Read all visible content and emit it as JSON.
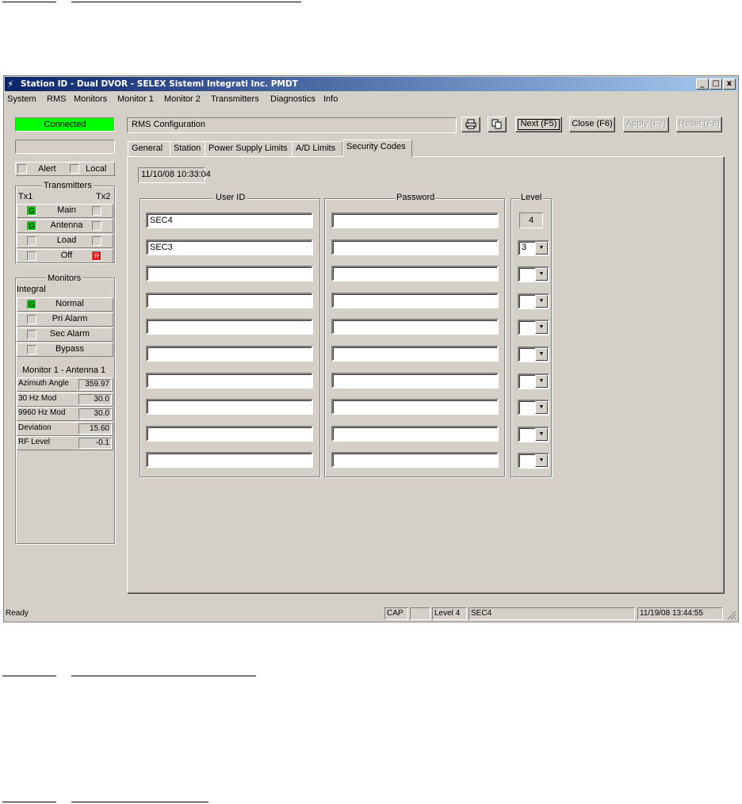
{
  "window": {
    "title": "Station ID - Dual DVOR - SELEX Sistemi Integrati Inc. PMDT",
    "controls": {
      "minimize": "_",
      "maximize": "□",
      "close": "x"
    }
  },
  "menu": [
    "System",
    "RMS",
    "Monitors",
    "Monitor 1",
    "Monitor 2",
    "Transmitters",
    "Diagnostics",
    "Info"
  ],
  "left_panel": {
    "connection_status": "Connected",
    "status_color": "#00ff00",
    "alert_label": "Alert",
    "local_label": "Local",
    "transmitters": {
      "title": "Transmitters",
      "tx1": "Tx1",
      "tx2": "Tx2",
      "rows": [
        {
          "label": "Main",
          "tx1": "G",
          "tx2": ""
        },
        {
          "label": "Antenna",
          "tx1": "G",
          "tx2": ""
        },
        {
          "label": "Load",
          "tx1": "",
          "tx2": ""
        },
        {
          "label": "Off",
          "tx1": "",
          "tx2": "R"
        }
      ]
    },
    "monitors": {
      "title": "Monitors",
      "integral": "Integral",
      "rows": [
        {
          "label": "Normal",
          "ind": "G"
        },
        {
          "label": "Pri Alarm",
          "ind": ""
        },
        {
          "label": "Sec Alarm",
          "ind": ""
        },
        {
          "label": "Bypass",
          "ind": ""
        }
      ],
      "monitor_title": "Monitor 1 - Antenna 1",
      "measurements": [
        {
          "label": "Azimuth Angle",
          "value": "359.97"
        },
        {
          "label": "30 Hz Mod",
          "value": "30.0"
        },
        {
          "label": "9960 Hz Mod",
          "value": "30.0"
        },
        {
          "label": "Deviation",
          "value": "15.60"
        },
        {
          "label": "RF Level",
          "value": "-0.1"
        }
      ]
    }
  },
  "header": {
    "title": "RMS Configuration",
    "buttons": {
      "next": "Next (F5)",
      "close": "Close (F6)",
      "apply": "Apply (F7)",
      "reset": "Reset (F8)"
    }
  },
  "tabs": [
    {
      "label": "General"
    },
    {
      "label": "Station"
    },
    {
      "label": "Power Supply Limits"
    },
    {
      "label": "A/D Limits"
    },
    {
      "label": "Security Codes"
    }
  ],
  "security": {
    "timestamp": "11/10/08 10:33:04",
    "user_id_title": "User ID",
    "password_title": "Password",
    "level_title": "Level",
    "rows": [
      {
        "user": "SEC4",
        "password": "",
        "level": "4",
        "fixed": true
      },
      {
        "user": "SEC3",
        "password": "",
        "level": "3",
        "fixed": false
      },
      {
        "user": "",
        "password": "",
        "level": "",
        "fixed": false
      },
      {
        "user": "",
        "password": "",
        "level": "",
        "fixed": false
      },
      {
        "user": "",
        "password": "",
        "level": "",
        "fixed": false
      },
      {
        "user": "",
        "password": "",
        "level": "",
        "fixed": false
      },
      {
        "user": "",
        "password": "",
        "level": "",
        "fixed": false
      },
      {
        "user": "",
        "password": "",
        "level": "",
        "fixed": false
      },
      {
        "user": "",
        "password": "",
        "level": "",
        "fixed": false
      },
      {
        "user": "",
        "password": "",
        "level": "",
        "fixed": false
      }
    ]
  },
  "status_bar": {
    "text": "Ready",
    "cap": "CAP",
    "level": "Level 4",
    "user": "SEC4",
    "datetime": "11/19/08 13:44:55"
  }
}
